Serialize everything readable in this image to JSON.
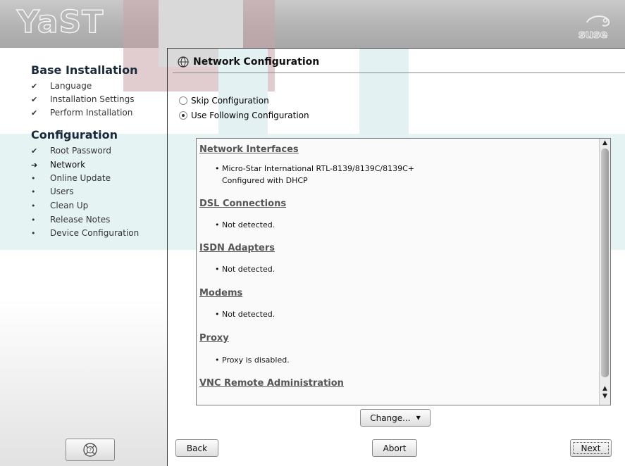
{
  "header": {
    "app_logo_text": "YaST",
    "brand_logo_text": "suse"
  },
  "sidebar": {
    "sections": [
      {
        "title": "Base Installation",
        "steps": [
          {
            "label": "Language",
            "status": "done",
            "mark": "✔"
          },
          {
            "label": "Installation Settings",
            "status": "done",
            "mark": "✔"
          },
          {
            "label": "Perform Installation",
            "status": "done",
            "mark": "✔"
          }
        ]
      },
      {
        "title": "Configuration",
        "steps": [
          {
            "label": "Root Password",
            "status": "done",
            "mark": "✔"
          },
          {
            "label": "Network",
            "status": "current",
            "mark": "➔"
          },
          {
            "label": "Online Update",
            "status": "pending",
            "mark": "•"
          },
          {
            "label": "Users",
            "status": "pending",
            "mark": "•"
          },
          {
            "label": "Clean Up",
            "status": "pending",
            "mark": "•"
          },
          {
            "label": "Release Notes",
            "status": "pending",
            "mark": "•"
          },
          {
            "label": "Device Configuration",
            "status": "pending",
            "mark": "•"
          }
        ]
      }
    ],
    "help_icon": "help-lifebuoy-icon"
  },
  "main": {
    "title": "Network Configuration",
    "title_icon": "network-globe-icon",
    "options": [
      {
        "label": "Skip Configuration",
        "selected": false
      },
      {
        "label": "Use Following Configuration",
        "selected": true
      }
    ],
    "summary": [
      {
        "heading": "Network Interfaces",
        "items": [
          "Micro-Star International RTL-8139/8139C/8139C+",
          "Configured with DHCP"
        ]
      },
      {
        "heading": "DSL Connections",
        "items": [
          "Not detected."
        ]
      },
      {
        "heading": "ISDN Adapters",
        "items": [
          "Not detected."
        ]
      },
      {
        "heading": "Modems",
        "items": [
          "Not detected."
        ]
      },
      {
        "heading": "Proxy",
        "items": [
          "Proxy is disabled."
        ]
      },
      {
        "heading": "VNC Remote Administration",
        "items": []
      }
    ],
    "change_button": "Change...",
    "buttons": {
      "back": "Back",
      "abort": "Abort",
      "next": "Next"
    }
  },
  "colors": {
    "header_bg": "#b8b8b8",
    "watermark_red": "#c8a3a8",
    "watermark_teal": "#e3f1f2",
    "heading_color": "#555555"
  }
}
